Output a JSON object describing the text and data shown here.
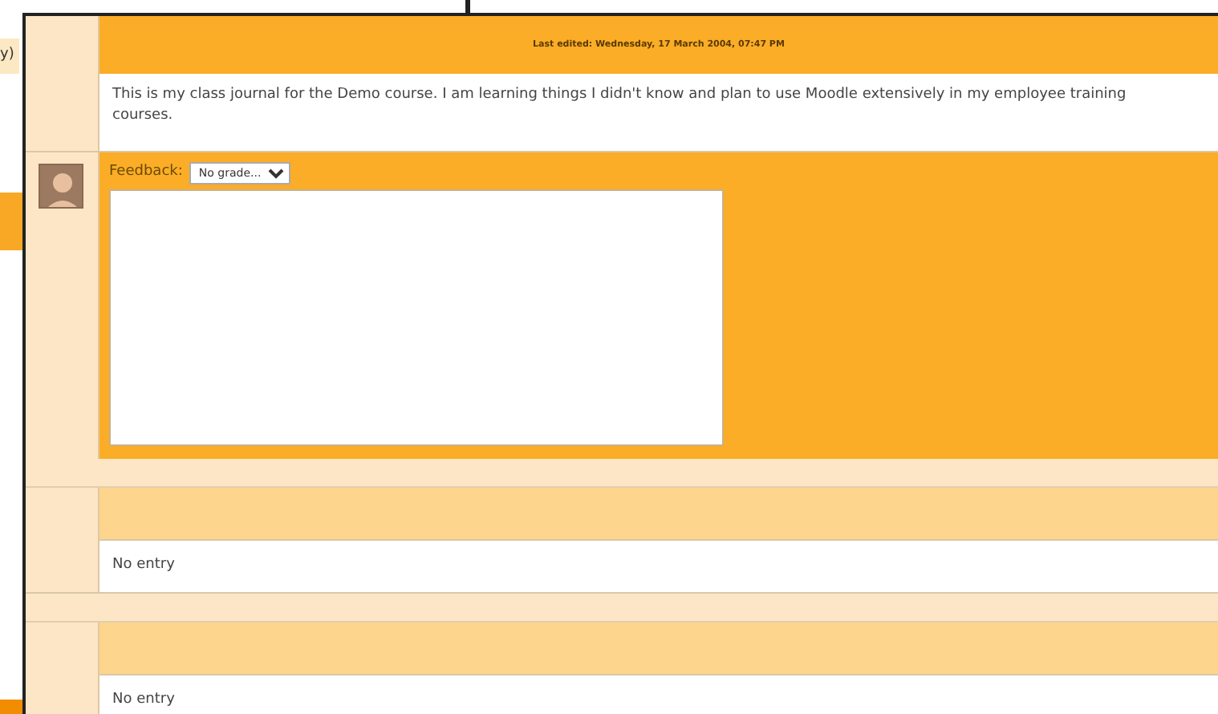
{
  "background_window": {
    "text_fragment": "y)"
  },
  "entries": [
    {
      "kind": "graded",
      "last_edited": "Last edited: Wednesday, 17 March 2004, 07:47 PM",
      "text": "This is my class journal for the Demo course. I am learning things I didn't know and plan to use Moodle extensively in my employee training courses.",
      "feedback": {
        "label": "Feedback:",
        "grade": "No grade..."
      }
    },
    {
      "kind": "empty",
      "text": "No entry"
    },
    {
      "kind": "empty",
      "text": "No entry"
    }
  ]
}
